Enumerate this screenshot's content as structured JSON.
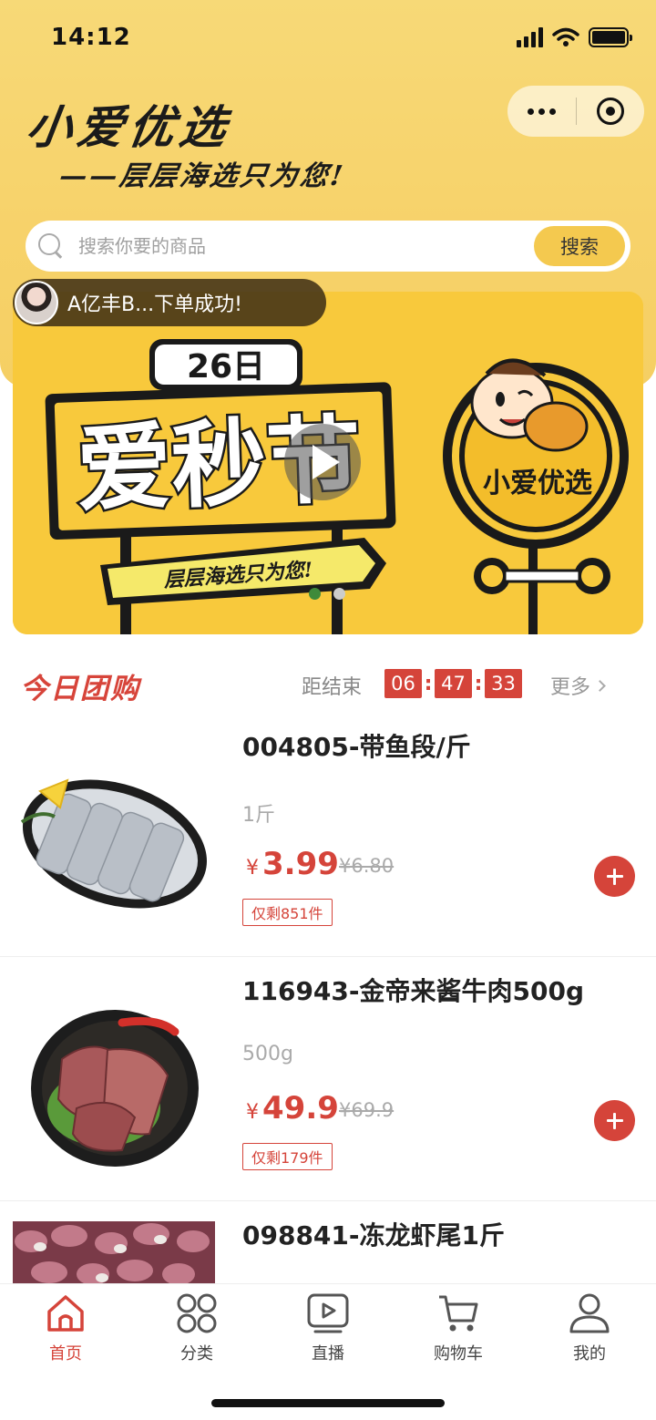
{
  "status_bar": {
    "time": "14:12"
  },
  "brand": {
    "title": "小爱优选",
    "slogan": "——层层海选只为您!"
  },
  "search": {
    "placeholder": "搜索你要的商品",
    "button_label": "搜索"
  },
  "banner": {
    "toast_text": "A亿丰B...下单成功!",
    "date_badge": "26日",
    "headline": "爱秒节",
    "sign_text": "层层海选只为您!",
    "mascot_label": "小爱优选",
    "slides": 2,
    "active_slide": 1
  },
  "group_buy": {
    "title": "今日团购",
    "countdown_label": "距结束",
    "countdown": {
      "hours": "06",
      "minutes": "47",
      "seconds": "33"
    },
    "more_label": "更多"
  },
  "products": [
    {
      "name": "004805-带鱼段/斤",
      "spec": "1斤",
      "currency": "¥",
      "price": "3.99",
      "original_price": "¥6.80",
      "stock_label": "仅剩851件",
      "image_icon": "hairtail-fish-image"
    },
    {
      "name": "116943-金帝来酱牛肉500g",
      "spec": "500g",
      "currency": "¥",
      "price": "49.9",
      "original_price": "¥69.9",
      "stock_label": "仅剩179件",
      "image_icon": "braised-beef-image"
    },
    {
      "name": "098841-冻龙虾尾1斤",
      "image_icon": "crayfish-tail-image"
    }
  ],
  "tab_bar": {
    "tabs": [
      {
        "label": "首页",
        "icon": "home-icon",
        "active": true
      },
      {
        "label": "分类",
        "icon": "category-icon",
        "active": false
      },
      {
        "label": "直播",
        "icon": "live-play-icon",
        "active": false
      },
      {
        "label": "购物车",
        "icon": "cart-icon",
        "active": false
      },
      {
        "label": "我的",
        "icon": "user-icon",
        "active": false
      }
    ]
  },
  "colors": {
    "accent_red": "#d5443a",
    "header_yellow": "#f7d977",
    "button_yellow": "#f4c94f"
  }
}
